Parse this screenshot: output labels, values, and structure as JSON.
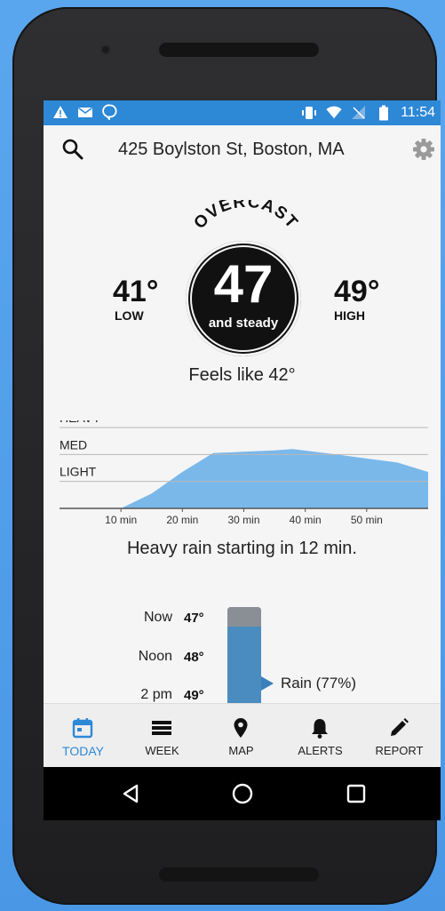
{
  "status_bar": {
    "time": "11:54",
    "left_icons": [
      "warning-icon",
      "mail-icon",
      "hangouts-icon"
    ],
    "right_icons": [
      "vibrate-icon",
      "wifi-icon",
      "no-signal-icon",
      "battery-icon"
    ]
  },
  "header": {
    "address": "425 Boylston St, Boston, MA"
  },
  "current": {
    "condition": "OVERCAST",
    "temperature": "47",
    "trend": "and steady",
    "low_value": "41°",
    "low_label": "LOW",
    "high_value": "49°",
    "high_label": "HIGH",
    "feels_like": "Feels like 42°"
  },
  "chart_data": {
    "type": "area",
    "title": "",
    "xlabel": "",
    "ylabel": "",
    "x": [
      0,
      10,
      15,
      20,
      25,
      30,
      35,
      38,
      45,
      50,
      55,
      60
    ],
    "values": [
      0,
      0,
      0.55,
      1.35,
      2.05,
      2.1,
      2.15,
      2.2,
      2.0,
      1.85,
      1.7,
      1.35
    ],
    "y_levels": [
      "LIGHT",
      "MED",
      "HEAVY"
    ],
    "y_level_values": [
      1,
      2,
      3
    ],
    "ylim": [
      0,
      3
    ],
    "xlim": [
      0,
      60
    ],
    "x_ticks": [
      10,
      20,
      30,
      40,
      50
    ],
    "x_tick_labels": [
      "10 min",
      "20 min",
      "30 min",
      "40 min",
      "50 min"
    ],
    "grid": true,
    "color": "#7ab8ea"
  },
  "precip_summary": "Heavy rain starting in 12 min.",
  "hourly": [
    {
      "label": "Now",
      "temp": "47°"
    },
    {
      "label": "Noon",
      "temp": "48°"
    },
    {
      "label": "2 pm",
      "temp": "49°"
    }
  ],
  "precip_bar": {
    "label": "Rain (77%)",
    "probability": 0.77
  },
  "nav": {
    "items": [
      {
        "label": "TODAY",
        "icon": "calendar-icon",
        "active": true
      },
      {
        "label": "WEEK",
        "icon": "list-icon",
        "active": false
      },
      {
        "label": "MAP",
        "icon": "map-pin-icon",
        "active": false
      },
      {
        "label": "ALERTS",
        "icon": "bell-icon",
        "active": false
      },
      {
        "label": "REPORT",
        "icon": "pencil-icon",
        "active": false
      }
    ]
  },
  "colors": {
    "accent": "#2d88d6",
    "chart_fill": "#7ab8ea",
    "bar_fill": "#4a8cc0",
    "bar_top": "#8a8f96"
  }
}
